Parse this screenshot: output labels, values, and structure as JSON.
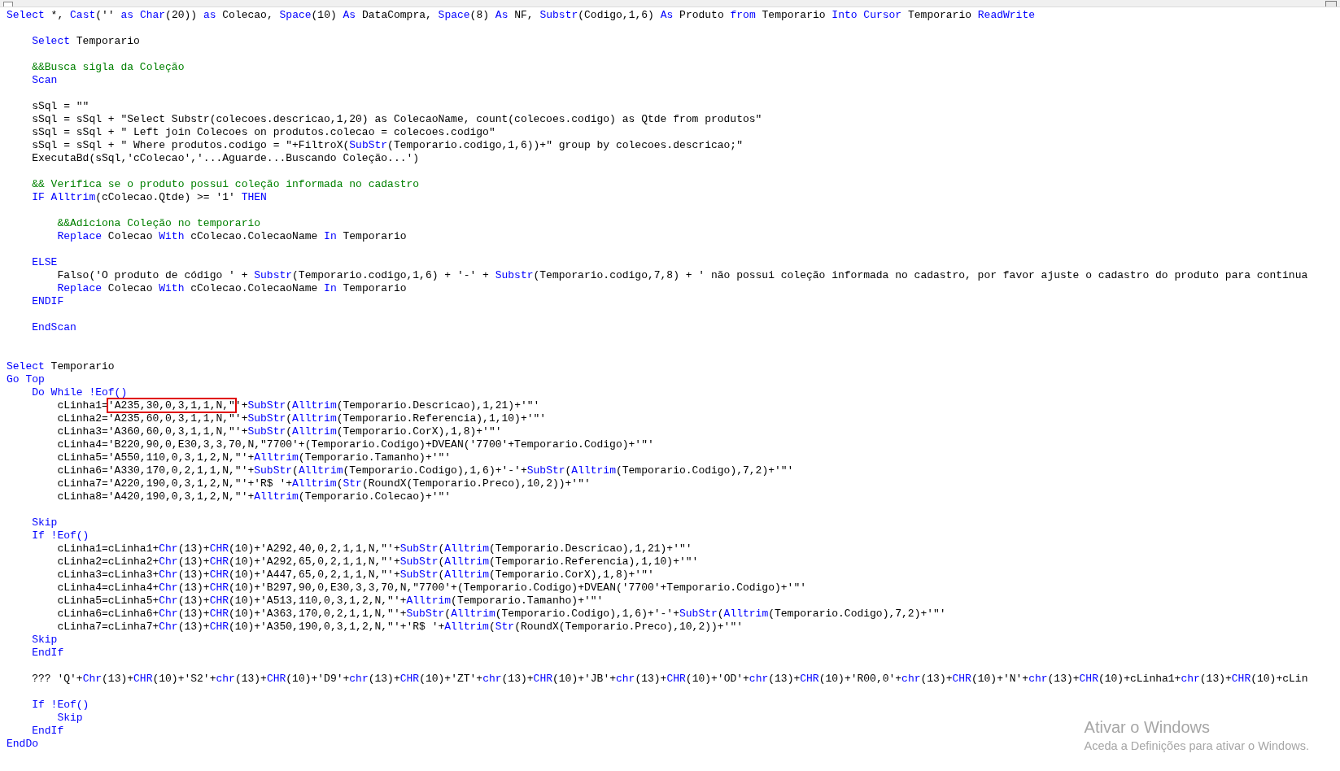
{
  "code_lines": [
    {
      "kind": "code",
      "segments": [
        {
          "text": "Select",
          "kind": "keyword"
        },
        {
          "text": " *, ",
          "kind": "plain"
        },
        {
          "text": "Cast",
          "kind": "keyword"
        },
        {
          "text": "('' ",
          "kind": "plain"
        },
        {
          "text": "as",
          "kind": "keyword"
        },
        {
          "text": " Char",
          "kind": "keyword"
        },
        {
          "text": "(20)) ",
          "kind": "plain"
        },
        {
          "text": "as",
          "kind": "keyword"
        },
        {
          "text": " Colecao, ",
          "kind": "plain"
        },
        {
          "text": "Space",
          "kind": "keyword"
        },
        {
          "text": "(10) ",
          "kind": "plain"
        },
        {
          "text": "As",
          "kind": "keyword"
        },
        {
          "text": " DataCompra, ",
          "kind": "plain"
        },
        {
          "text": "Space",
          "kind": "keyword"
        },
        {
          "text": "(8) ",
          "kind": "plain"
        },
        {
          "text": "As",
          "kind": "keyword"
        },
        {
          "text": " NF, ",
          "kind": "plain"
        },
        {
          "text": "Substr",
          "kind": "keyword"
        },
        {
          "text": "(Codigo,1,6) ",
          "kind": "plain"
        },
        {
          "text": "As",
          "kind": "keyword"
        },
        {
          "text": " Produto ",
          "kind": "plain"
        },
        {
          "text": "from",
          "kind": "keyword"
        },
        {
          "text": " Temporario ",
          "kind": "plain"
        },
        {
          "text": "Into Cursor",
          "kind": "keyword"
        },
        {
          "text": " Temporario ",
          "kind": "plain"
        },
        {
          "text": "ReadWrite",
          "kind": "keyword"
        }
      ]
    },
    {
      "kind": "blank"
    },
    {
      "kind": "code",
      "segments": [
        {
          "text": "    Select",
          "kind": "keyword"
        },
        {
          "text": " Temporario",
          "kind": "plain"
        }
      ]
    },
    {
      "kind": "blank"
    },
    {
      "kind": "code",
      "segments": [
        {
          "text": "    &&Busca sigla da Coleção",
          "kind": "comment"
        }
      ]
    },
    {
      "kind": "code",
      "segments": [
        {
          "text": "    Scan",
          "kind": "keyword"
        }
      ]
    },
    {
      "kind": "blank"
    },
    {
      "kind": "code",
      "segments": [
        {
          "text": "    sSql = \"\"",
          "kind": "plain"
        }
      ]
    },
    {
      "kind": "code",
      "segments": [
        {
          "text": "    sSql = sSql + \"Select Substr(colecoes.descricao,1,20) as ColecaoName, count(colecoes.codigo) as Qtde from produtos\"",
          "kind": "plain"
        }
      ]
    },
    {
      "kind": "code",
      "segments": [
        {
          "text": "    sSql = sSql + \" Left join Colecoes on produtos.colecao = colecoes.codigo\"",
          "kind": "plain"
        }
      ]
    },
    {
      "kind": "code",
      "segments": [
        {
          "text": "    sSql = sSql + \" Where produtos.codigo = \"+FiltroX(",
          "kind": "plain"
        },
        {
          "text": "SubStr",
          "kind": "keyword"
        },
        {
          "text": "(Temporario.codigo,1,6))+\" group by colecoes.descricao;\"",
          "kind": "plain"
        }
      ]
    },
    {
      "kind": "code",
      "segments": [
        {
          "text": "    ExecutaBd(sSql,'cColecao','...Aguarde...Buscando Coleção...')",
          "kind": "plain"
        }
      ]
    },
    {
      "kind": "blank"
    },
    {
      "kind": "code",
      "segments": [
        {
          "text": "    && Verifica se o produto possui coleção informada no cadastro",
          "kind": "comment"
        }
      ]
    },
    {
      "kind": "code",
      "segments": [
        {
          "text": "    IF Alltrim",
          "kind": "keyword"
        },
        {
          "text": "(cColecao.Qtde) >= '1' ",
          "kind": "plain"
        },
        {
          "text": "THEN",
          "kind": "keyword"
        }
      ]
    },
    {
      "kind": "blank"
    },
    {
      "kind": "code",
      "segments": [
        {
          "text": "        &&Adiciona Coleção no temporario",
          "kind": "comment"
        }
      ]
    },
    {
      "kind": "code",
      "segments": [
        {
          "text": "        Replace",
          "kind": "keyword"
        },
        {
          "text": " Colecao ",
          "kind": "plain"
        },
        {
          "text": "With",
          "kind": "keyword"
        },
        {
          "text": " cColecao.ColecaoName ",
          "kind": "plain"
        },
        {
          "text": "In",
          "kind": "keyword"
        },
        {
          "text": " Temporario",
          "kind": "plain"
        }
      ]
    },
    {
      "kind": "blank"
    },
    {
      "kind": "code",
      "segments": [
        {
          "text": "    ELSE",
          "kind": "keyword"
        }
      ]
    },
    {
      "kind": "code",
      "segments": [
        {
          "text": "        Falso('O produto de código ' + ",
          "kind": "plain"
        },
        {
          "text": "Substr",
          "kind": "keyword"
        },
        {
          "text": "(Temporario.codigo,1,6) + '-' + ",
          "kind": "plain"
        },
        {
          "text": "Substr",
          "kind": "keyword"
        },
        {
          "text": "(Temporario.codigo,7,8) + ' não possui coleção informada no cadastro, por favor ajuste o cadastro do produto para continua",
          "kind": "plain"
        }
      ]
    },
    {
      "kind": "code",
      "segments": [
        {
          "text": "        Replace",
          "kind": "keyword"
        },
        {
          "text": " Colecao ",
          "kind": "plain"
        },
        {
          "text": "With",
          "kind": "keyword"
        },
        {
          "text": " cColecao.ColecaoName ",
          "kind": "plain"
        },
        {
          "text": "In",
          "kind": "keyword"
        },
        {
          "text": " Temporario",
          "kind": "plain"
        }
      ]
    },
    {
      "kind": "code",
      "segments": [
        {
          "text": "    ENDIF",
          "kind": "keyword"
        }
      ]
    },
    {
      "kind": "blank"
    },
    {
      "kind": "code",
      "segments": [
        {
          "text": "    EndScan",
          "kind": "keyword"
        }
      ]
    },
    {
      "kind": "blank"
    },
    {
      "kind": "blank"
    },
    {
      "kind": "code",
      "segments": [
        {
          "text": "Select",
          "kind": "keyword"
        },
        {
          "text": " Temporario",
          "kind": "plain"
        }
      ]
    },
    {
      "kind": "code",
      "segments": [
        {
          "text": "Go Top",
          "kind": "keyword"
        }
      ]
    },
    {
      "kind": "code",
      "segments": [
        {
          "text": "    Do While !Eof()",
          "kind": "keyword"
        }
      ]
    },
    {
      "kind": "code",
      "segments": [
        {
          "text": "        cLinha1=",
          "kind": "plain"
        },
        {
          "text": "'A235,30,0,3,1,1,N,\"",
          "kind": "boxed"
        },
        {
          "text": "'+",
          "kind": "plain"
        },
        {
          "text": "SubStr",
          "kind": "keyword"
        },
        {
          "text": "(",
          "kind": "plain"
        },
        {
          "text": "Alltrim",
          "kind": "keyword"
        },
        {
          "text": "(Temporario.Descricao),1,21)+'\"'",
          "kind": "plain"
        }
      ]
    },
    {
      "kind": "code",
      "segments": [
        {
          "text": "        cLinha2='A235,60,0,3,1,1,N,\"'+",
          "kind": "plain"
        },
        {
          "text": "SubStr",
          "kind": "keyword"
        },
        {
          "text": "(",
          "kind": "plain"
        },
        {
          "text": "Alltrim",
          "kind": "keyword"
        },
        {
          "text": "(Temporario.Referencia),1,10)+'\"'",
          "kind": "plain"
        }
      ]
    },
    {
      "kind": "code",
      "segments": [
        {
          "text": "        cLinha3='A360,60,0,3,1,1,N,\"'+",
          "kind": "plain"
        },
        {
          "text": "SubStr",
          "kind": "keyword"
        },
        {
          "text": "(",
          "kind": "plain"
        },
        {
          "text": "Alltrim",
          "kind": "keyword"
        },
        {
          "text": "(Temporario.CorX),1,8)+'\"'",
          "kind": "plain"
        }
      ]
    },
    {
      "kind": "code",
      "segments": [
        {
          "text": "        cLinha4='B220,90,0,E30,3,3,70,N,\"7700'+(Temporario.Codigo)+DVEAN('7700'+Temporario.Codigo)+'\"'",
          "kind": "plain"
        }
      ]
    },
    {
      "kind": "code",
      "segments": [
        {
          "text": "        cLinha5='A550,110,0,3,1,2,N,\"'+",
          "kind": "plain"
        },
        {
          "text": "Alltrim",
          "kind": "keyword"
        },
        {
          "text": "(Temporario.Tamanho)+'\"'",
          "kind": "plain"
        }
      ]
    },
    {
      "kind": "code",
      "segments": [
        {
          "text": "        cLinha6='A330,170,0,2,1,1,N,\"'+",
          "kind": "plain"
        },
        {
          "text": "SubStr",
          "kind": "keyword"
        },
        {
          "text": "(",
          "kind": "plain"
        },
        {
          "text": "Alltrim",
          "kind": "keyword"
        },
        {
          "text": "(Temporario.Codigo),1,6)+'-'+",
          "kind": "plain"
        },
        {
          "text": "SubStr",
          "kind": "keyword"
        },
        {
          "text": "(",
          "kind": "plain"
        },
        {
          "text": "Alltrim",
          "kind": "keyword"
        },
        {
          "text": "(Temporario.Codigo),7,2)+'\"'",
          "kind": "plain"
        }
      ]
    },
    {
      "kind": "code",
      "segments": [
        {
          "text": "        cLinha7='A220,190,0,3,1,2,N,\"'+'R$ '+",
          "kind": "plain"
        },
        {
          "text": "Alltrim",
          "kind": "keyword"
        },
        {
          "text": "(",
          "kind": "plain"
        },
        {
          "text": "Str",
          "kind": "keyword"
        },
        {
          "text": "(RoundX(Temporario.Preco),10,2))+'\"'",
          "kind": "plain"
        }
      ]
    },
    {
      "kind": "code",
      "segments": [
        {
          "text": "        cLinha8='A420,190,0,3,1,2,N,\"'+",
          "kind": "plain"
        },
        {
          "text": "Alltrim",
          "kind": "keyword"
        },
        {
          "text": "(Temporario.Colecao)+'\"'",
          "kind": "plain"
        }
      ]
    },
    {
      "kind": "blank"
    },
    {
      "kind": "code",
      "segments": [
        {
          "text": "    Skip",
          "kind": "keyword"
        }
      ]
    },
    {
      "kind": "code",
      "segments": [
        {
          "text": "    If !Eof()",
          "kind": "keyword"
        }
      ]
    },
    {
      "kind": "code",
      "segments": [
        {
          "text": "        cLinha1=cLinha1+",
          "kind": "plain"
        },
        {
          "text": "Chr",
          "kind": "keyword"
        },
        {
          "text": "(13)+",
          "kind": "plain"
        },
        {
          "text": "CHR",
          "kind": "keyword"
        },
        {
          "text": "(10)+'A292,40,0,2,1,1,N,\"'+",
          "kind": "plain"
        },
        {
          "text": "SubStr",
          "kind": "keyword"
        },
        {
          "text": "(",
          "kind": "plain"
        },
        {
          "text": "Alltrim",
          "kind": "keyword"
        },
        {
          "text": "(Temporario.Descricao),1,21)+'\"'",
          "kind": "plain"
        }
      ]
    },
    {
      "kind": "code",
      "segments": [
        {
          "text": "        cLinha2=cLinha2+",
          "kind": "plain"
        },
        {
          "text": "Chr",
          "kind": "keyword"
        },
        {
          "text": "(13)+",
          "kind": "plain"
        },
        {
          "text": "CHR",
          "kind": "keyword"
        },
        {
          "text": "(10)+'A292,65,0,2,1,1,N,\"'+",
          "kind": "plain"
        },
        {
          "text": "SubStr",
          "kind": "keyword"
        },
        {
          "text": "(",
          "kind": "plain"
        },
        {
          "text": "Alltrim",
          "kind": "keyword"
        },
        {
          "text": "(Temporario.Referencia),1,10)+'\"'",
          "kind": "plain"
        }
      ]
    },
    {
      "kind": "code",
      "segments": [
        {
          "text": "        cLinha3=cLinha3+",
          "kind": "plain"
        },
        {
          "text": "Chr",
          "kind": "keyword"
        },
        {
          "text": "(13)+",
          "kind": "plain"
        },
        {
          "text": "CHR",
          "kind": "keyword"
        },
        {
          "text": "(10)+'A447,65,0,2,1,1,N,\"'+",
          "kind": "plain"
        },
        {
          "text": "SubStr",
          "kind": "keyword"
        },
        {
          "text": "(",
          "kind": "plain"
        },
        {
          "text": "Alltrim",
          "kind": "keyword"
        },
        {
          "text": "(Temporario.CorX),1,8)+'\"'",
          "kind": "plain"
        }
      ]
    },
    {
      "kind": "code",
      "segments": [
        {
          "text": "        cLinha4=cLinha4+",
          "kind": "plain"
        },
        {
          "text": "Chr",
          "kind": "keyword"
        },
        {
          "text": "(13)+",
          "kind": "plain"
        },
        {
          "text": "CHR",
          "kind": "keyword"
        },
        {
          "text": "(10)+'B297,90,0,E30,3,3,70,N,\"7700'+(Temporario.Codigo)+DVEAN('7700'+Temporario.Codigo)+'\"'",
          "kind": "plain"
        }
      ]
    },
    {
      "kind": "code",
      "segments": [
        {
          "text": "        cLinha5=cLinha5+",
          "kind": "plain"
        },
        {
          "text": "Chr",
          "kind": "keyword"
        },
        {
          "text": "(13)+",
          "kind": "plain"
        },
        {
          "text": "CHR",
          "kind": "keyword"
        },
        {
          "text": "(10)+'A513,110,0,3,1,2,N,\"'+",
          "kind": "plain"
        },
        {
          "text": "Alltrim",
          "kind": "keyword"
        },
        {
          "text": "(Temporario.Tamanho)+'\"'",
          "kind": "plain"
        }
      ]
    },
    {
      "kind": "code",
      "segments": [
        {
          "text": "        cLinha6=cLinha6+",
          "kind": "plain"
        },
        {
          "text": "Chr",
          "kind": "keyword"
        },
        {
          "text": "(13)+",
          "kind": "plain"
        },
        {
          "text": "CHR",
          "kind": "keyword"
        },
        {
          "text": "(10)+'A363,170,0,2,1,1,N,\"'+",
          "kind": "plain"
        },
        {
          "text": "SubStr",
          "kind": "keyword"
        },
        {
          "text": "(",
          "kind": "plain"
        },
        {
          "text": "Alltrim",
          "kind": "keyword"
        },
        {
          "text": "(Temporario.Codigo),1,6)+'-'+",
          "kind": "plain"
        },
        {
          "text": "SubStr",
          "kind": "keyword"
        },
        {
          "text": "(",
          "kind": "plain"
        },
        {
          "text": "Alltrim",
          "kind": "keyword"
        },
        {
          "text": "(Temporario.Codigo),7,2)+'\"'",
          "kind": "plain"
        }
      ]
    },
    {
      "kind": "code",
      "segments": [
        {
          "text": "        cLinha7=cLinha7+",
          "kind": "plain"
        },
        {
          "text": "Chr",
          "kind": "keyword"
        },
        {
          "text": "(13)+",
          "kind": "plain"
        },
        {
          "text": "CHR",
          "kind": "keyword"
        },
        {
          "text": "(10)+'A350,190,0,3,1,2,N,\"'+'R$ '+",
          "kind": "plain"
        },
        {
          "text": "Alltrim",
          "kind": "keyword"
        },
        {
          "text": "(",
          "kind": "plain"
        },
        {
          "text": "Str",
          "kind": "keyword"
        },
        {
          "text": "(RoundX(Temporario.Preco),10,2))+'\"'",
          "kind": "plain"
        }
      ]
    },
    {
      "kind": "code",
      "segments": [
        {
          "text": "    Skip",
          "kind": "keyword"
        }
      ]
    },
    {
      "kind": "code",
      "segments": [
        {
          "text": "    EndIf",
          "kind": "keyword"
        }
      ]
    },
    {
      "kind": "blank"
    },
    {
      "kind": "code",
      "segments": [
        {
          "text": "    ??? 'Q'+",
          "kind": "plain"
        },
        {
          "text": "Chr",
          "kind": "keyword"
        },
        {
          "text": "(13)+",
          "kind": "plain"
        },
        {
          "text": "CHR",
          "kind": "keyword"
        },
        {
          "text": "(10)+'S2'+",
          "kind": "plain"
        },
        {
          "text": "chr",
          "kind": "keyword"
        },
        {
          "text": "(13)+",
          "kind": "plain"
        },
        {
          "text": "CHR",
          "kind": "keyword"
        },
        {
          "text": "(10)+'D9'+",
          "kind": "plain"
        },
        {
          "text": "chr",
          "kind": "keyword"
        },
        {
          "text": "(13)+",
          "kind": "plain"
        },
        {
          "text": "CHR",
          "kind": "keyword"
        },
        {
          "text": "(10)+'ZT'+",
          "kind": "plain"
        },
        {
          "text": "chr",
          "kind": "keyword"
        },
        {
          "text": "(13)+",
          "kind": "plain"
        },
        {
          "text": "CHR",
          "kind": "keyword"
        },
        {
          "text": "(10)+'JB'+",
          "kind": "plain"
        },
        {
          "text": "chr",
          "kind": "keyword"
        },
        {
          "text": "(13)+",
          "kind": "plain"
        },
        {
          "text": "CHR",
          "kind": "keyword"
        },
        {
          "text": "(10)+'OD'+",
          "kind": "plain"
        },
        {
          "text": "chr",
          "kind": "keyword"
        },
        {
          "text": "(13)+",
          "kind": "plain"
        },
        {
          "text": "CHR",
          "kind": "keyword"
        },
        {
          "text": "(10)+'R00,0'+",
          "kind": "plain"
        },
        {
          "text": "chr",
          "kind": "keyword"
        },
        {
          "text": "(13)+",
          "kind": "plain"
        },
        {
          "text": "CHR",
          "kind": "keyword"
        },
        {
          "text": "(10)+'N'+",
          "kind": "plain"
        },
        {
          "text": "chr",
          "kind": "keyword"
        },
        {
          "text": "(13)+",
          "kind": "plain"
        },
        {
          "text": "CHR",
          "kind": "keyword"
        },
        {
          "text": "(10)+cLinha1+",
          "kind": "plain"
        },
        {
          "text": "chr",
          "kind": "keyword"
        },
        {
          "text": "(13)+",
          "kind": "plain"
        },
        {
          "text": "CHR",
          "kind": "keyword"
        },
        {
          "text": "(10)+cLin",
          "kind": "plain"
        }
      ]
    },
    {
      "kind": "blank"
    },
    {
      "kind": "code",
      "segments": [
        {
          "text": "    If !Eof()",
          "kind": "keyword"
        }
      ]
    },
    {
      "kind": "code",
      "segments": [
        {
          "text": "        Skip",
          "kind": "keyword"
        }
      ]
    },
    {
      "kind": "code",
      "segments": [
        {
          "text": "    EndIf",
          "kind": "keyword"
        }
      ]
    },
    {
      "kind": "code",
      "segments": [
        {
          "text": "EndDo",
          "kind": "keyword"
        }
      ]
    }
  ],
  "activation_notice": {
    "title": "Ativar o Windows",
    "subtitle": "Aceda a Definições para ativar o Windows."
  }
}
